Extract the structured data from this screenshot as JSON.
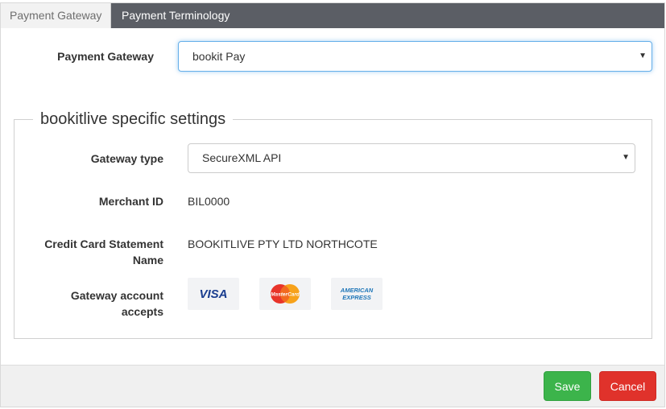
{
  "tabs": [
    {
      "label": "Payment Gateway",
      "active": true
    },
    {
      "label": "Payment Terminology",
      "active": false
    }
  ],
  "payment_gateway": {
    "label": "Payment Gateway",
    "selected": "bookit Pay"
  },
  "specific_settings": {
    "legend": "bookitlive specific settings",
    "gateway_type": {
      "label": "Gateway type",
      "selected": "SecureXML API"
    },
    "merchant_id": {
      "label": "Merchant ID",
      "value": "BIL0000"
    },
    "statement_name": {
      "label_line1": "Credit Card Statement",
      "label_line2": "Name",
      "value": "BOOKITLIVE PTY LTD NORTHCOTE"
    },
    "accepts": {
      "label_line1": "Gateway account",
      "label_line2": "accepts",
      "cards": [
        {
          "icon": "visa-logo-icon",
          "text": "VISA"
        },
        {
          "icon": "mastercard-logo-icon",
          "text": "MasterCard"
        },
        {
          "icon": "american-express-logo-icon",
          "text_line1": "AMERICAN",
          "text_line2": "EXPRESS"
        }
      ]
    }
  },
  "footer": {
    "save_label": "Save",
    "cancel_label": "Cancel"
  },
  "colors": {
    "tabbar": "#5b5e65",
    "save": "#3cb44b",
    "cancel": "#e0322b",
    "focus": "#66afe9"
  }
}
